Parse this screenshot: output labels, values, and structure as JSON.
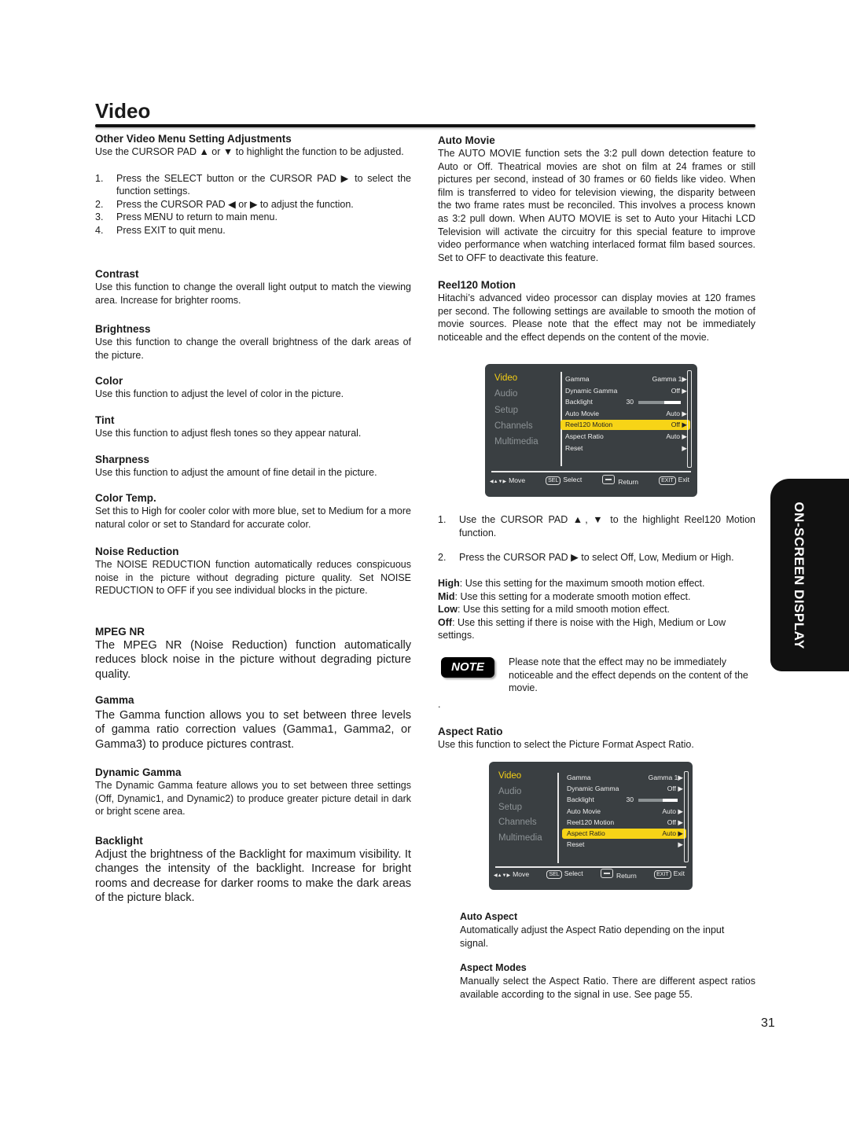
{
  "page": {
    "title": "Video",
    "side_tab": "ON-SCREEN DISPLAY",
    "page_number": "31"
  },
  "left": {
    "intro": {
      "heading": "Other Video Menu Setting Adjustments",
      "text": "Use the CURSOR PAD ▲ or ▼ to highlight the function to be adjusted.",
      "steps": [
        {
          "n": "1.",
          "text": "Press the SELECT button or the CURSOR PAD ▶ to select the function settings."
        },
        {
          "n": "2.",
          "text": "Press the CURSOR PAD ◀ or ▶ to adjust the function."
        },
        {
          "n": "3.",
          "text": "Press MENU to return to main menu."
        },
        {
          "n": "4.",
          "text": "Press EXIT to quit menu."
        }
      ]
    },
    "sections": [
      {
        "heading": "Contrast",
        "text": "Use this function to change the overall light output to match the viewing area. Increase for brighter rooms."
      },
      {
        "heading": "Brightness",
        "text": "Use this function to change the overall brightness of the dark areas of the picture."
      },
      {
        "heading": "Color",
        "text": "Use this function to adjust the level of color in the picture."
      },
      {
        "heading": "Tint",
        "text": "Use this function to adjust flesh tones so they appear natural."
      },
      {
        "heading": "Sharpness",
        "text": "Use this function to adjust the amount of fine detail in the picture."
      },
      {
        "heading": "Color Temp.",
        "text": "Set this to High for cooler color with more blue, set to Medium for a more natural color or set to Standard for accurate color."
      },
      {
        "heading": "Noise Reduction",
        "text": "The NOISE REDUCTION function automatically reduces conspicuous noise in the picture without degrading picture quality. Set NOISE REDUCTION to OFF if you see individual blocks in the picture."
      },
      {
        "heading": "MPEG NR",
        "text": "The MPEG NR (Noise Reduction) function automatically reduces block noise in the picture without degrading picture quality."
      },
      {
        "heading": "Gamma",
        "text": "The Gamma function allows you to set between three levels of gamma ratio correction values (Gamma1, Gamma2, or Gamma3) to produce pictures contrast."
      },
      {
        "heading": "Dynamic Gamma",
        "text": "The Dynamic Gamma feature allows you to set between three settings (Off, Dynamic1, and Dynamic2) to produce greater picture detail in dark or bright scene area."
      },
      {
        "heading": "Backlight",
        "text": "Adjust the brightness of the Backlight for maximum visibility. It changes the intensity of the backlight. Increase for bright rooms and decrease for darker rooms to make the dark areas of the picture black."
      }
    ]
  },
  "right": {
    "auto_movie": {
      "heading": "Auto Movie",
      "text": "The AUTO MOVIE function sets the 3:2 pull down detection feature to Auto or Off. Theatrical movies are shot on film at 24 frames or still pictures per second, instead of 30 frames or 60 fields like video. When film is transferred to video for television viewing, the disparity between the two frame rates must be reconciled. This involves a process known as 3:2 pull down. When AUTO MOVIE is set to Auto your Hitachi LCD Television will activate the circuitry for this special feature to improve video performance when watching interlaced format film based sources. Set to OFF to deactivate this feature."
    },
    "reel120": {
      "heading": "Reel120 Motion",
      "text": "Hitachi’s advanced video processor can display movies at 120 frames per second. The following settings are available to smooth the motion of movie sources. Please note that the effect may not be immediately noticeable and the effect depends on the content of the movie.",
      "steps": [
        {
          "n": "1.",
          "text": "Use the CURSOR PAD ▲, ▼ to the highlight Reel120 Motion function."
        },
        {
          "n": "2.",
          "text": "Press the CURSOR PAD ▶ to select Off, Low, Medium or High."
        }
      ],
      "options": [
        {
          "term": "High",
          "text": ": Use this setting for the maximum smooth motion effect."
        },
        {
          "term": "Mid",
          "text": ": Use this setting for a moderate smooth motion effect."
        },
        {
          "term": "Low",
          "text": ": Use this setting for a mild smooth motion effect."
        },
        {
          "term": "Off",
          "text": ": Use this setting if there is noise with the High, Medium or Low settings."
        }
      ],
      "note_label": "NOTE",
      "note_text": "Please note that the effect may no be immediately noticeable and the effect depends on the content of the movie.",
      "stray_dot": "."
    },
    "aspect_ratio": {
      "heading": "Aspect Ratio",
      "text": "Use this function to select the Picture Format Aspect Ratio.",
      "sub": [
        {
          "heading": "Auto Aspect",
          "text": "Automatically adjust the Aspect Ratio depending on the input signal."
        },
        {
          "heading": "Aspect Modes",
          "text": "Manually select the Aspect Ratio. There are different aspect ratios available according to the signal in use. See page 55."
        }
      ]
    }
  },
  "osd_menus": [
    {
      "categories": [
        "Video",
        "Audio",
        "Setup",
        "Channels",
        "Multimedia"
      ],
      "active_category": "Video",
      "items": [
        {
          "label": "Gamma",
          "value": "Gamma 1▶"
        },
        {
          "label": "Dynamic Gamma",
          "value": "Off ▶"
        },
        {
          "label": "Backlight",
          "value": "30",
          "slider_level": 0.3
        },
        {
          "label": "Auto Movie",
          "value": "Auto ▶"
        },
        {
          "label": "Reel120 Motion",
          "value": "Off ▶"
        },
        {
          "label": "Aspect Ratio",
          "value": "Auto ▶"
        },
        {
          "label": "Reset",
          "value": "▶"
        }
      ],
      "selected_item": "Reel120 Motion",
      "footer": {
        "move": "Move",
        "sel_key": "SEL",
        "select": "Select",
        "return": "Return",
        "exit_key": "EXIT",
        "exit": "Exit",
        "move_icon": "◀▲▼▶"
      }
    },
    {
      "categories": [
        "Video",
        "Audio",
        "Setup",
        "Channels",
        "Multimedia"
      ],
      "active_category": "Video",
      "items": [
        {
          "label": "Gamma",
          "value": "Gamma 1▶"
        },
        {
          "label": "Dynamic Gamma",
          "value": "Off ▶"
        },
        {
          "label": "Backlight",
          "value": "30",
          "slider_level": 0.3
        },
        {
          "label": "Auto Movie",
          "value": "Auto ▶"
        },
        {
          "label": "Reel120 Motion",
          "value": "Off ▶"
        },
        {
          "label": "Aspect Ratio",
          "value": "Auto ▶"
        },
        {
          "label": "Reset",
          "value": "▶"
        }
      ],
      "selected_item": "Aspect Ratio",
      "footer": {
        "move": "Move",
        "sel_key": "SEL",
        "select": "Select",
        "return": "Return",
        "exit_key": "EXIT",
        "exit": "Exit",
        "move_icon": "◀▲▼▶"
      }
    }
  ],
  "colors": {
    "osd_bg": "#3a3f42",
    "osd_highlight": "#f7d417",
    "osd_active_category": "#f5cf14",
    "osd_inactive_category": "#8d9396"
  }
}
